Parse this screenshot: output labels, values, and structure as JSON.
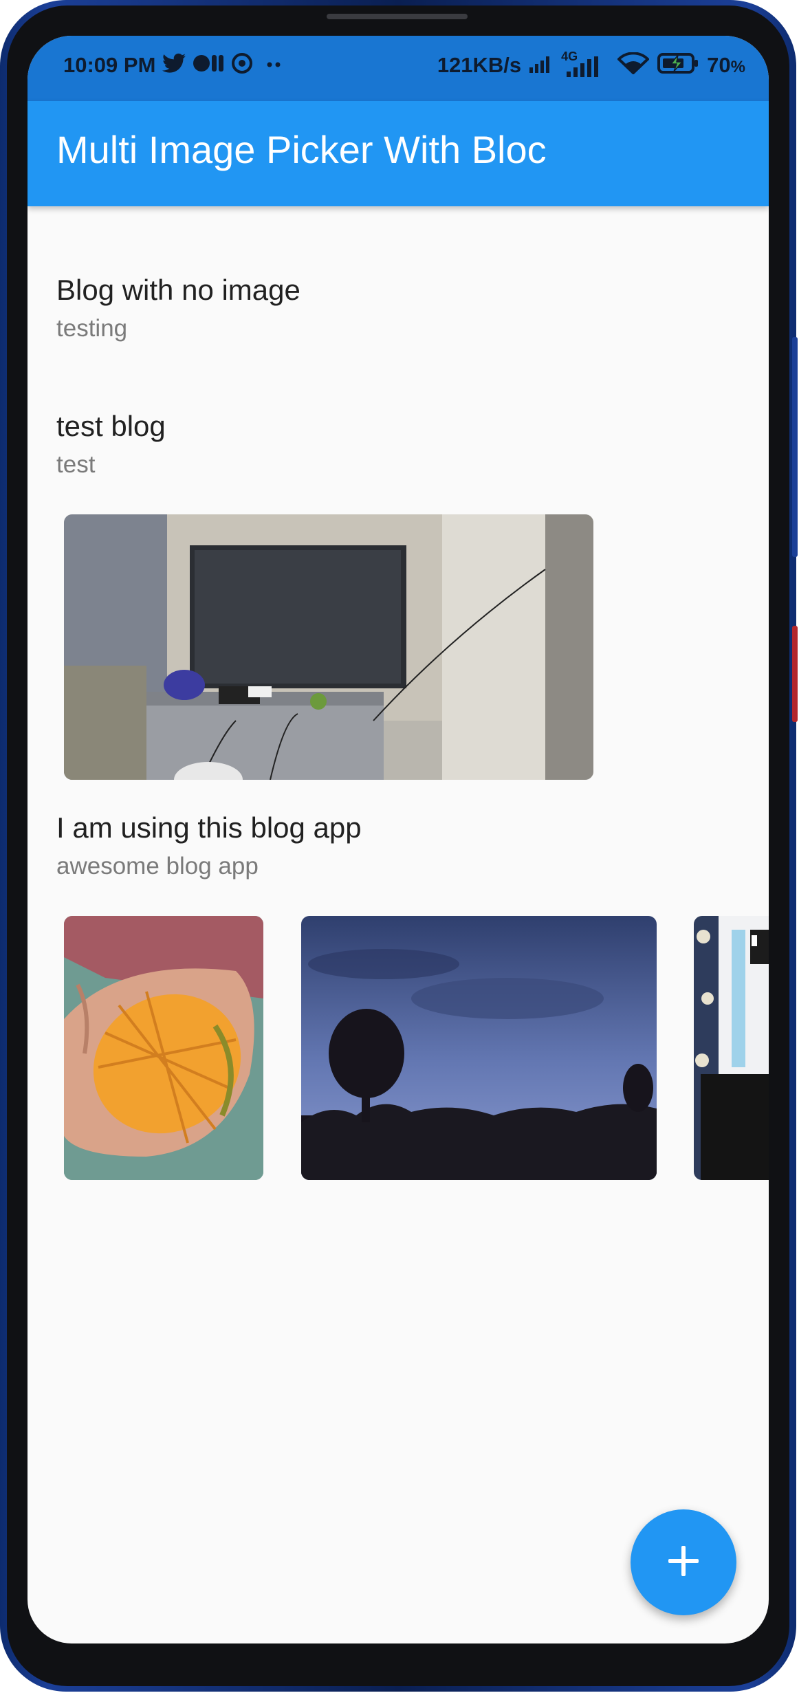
{
  "status_bar": {
    "time": "10:09 PM",
    "net_speed": "121KB/s",
    "network_type": "4G",
    "battery": "70",
    "battery_unit": "%",
    "icons": [
      "twitter-icon",
      "media-icon",
      "vpn-icon",
      "more-dots-icon",
      "signal-icon",
      "wifi-icon",
      "battery-icon"
    ]
  },
  "app_bar": {
    "title": "Multi Image Picker With Bloc"
  },
  "blogs": [
    {
      "title": "Blog with no image",
      "description": "testing",
      "images": []
    },
    {
      "title": "test blog",
      "description": "test",
      "images": [
        "tv-room-photo"
      ]
    },
    {
      "title": "I am using this blog app",
      "description": "awesome blog app",
      "images": [
        "mango-photo",
        "sky-photo",
        "shirt-photo"
      ]
    }
  ],
  "fab": {
    "icon": "plus-icon"
  },
  "colors": {
    "primary": "#2196f3",
    "status_bar": "#1976d2",
    "background": "#fafafa"
  }
}
